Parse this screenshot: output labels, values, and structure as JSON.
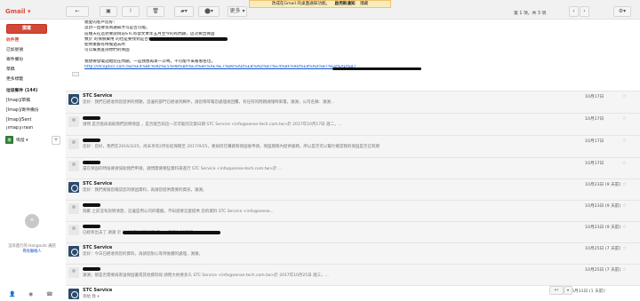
{
  "topbar": {
    "app_label": "Gmail ▾",
    "back": "←",
    "archive": "▣",
    "spam": "!",
    "delete": "🗑",
    "folder": "▰▾",
    "label": "⬤▾",
    "more": "更多 ▾",
    "notice_text": "改成在Gmail 的桌面通知功能。",
    "notice_enable": "啟用新通知",
    "notice_ignore": "隱藏",
    "pager": "第 1 項，共 3 項",
    "prev": "‹",
    "next": "›",
    "settings": "⚙▾"
  },
  "sidebar": {
    "compose": "撰寫",
    "items": [
      "收件匣",
      "已加星號",
      "寄件備份",
      "草稿",
      "更多標籤",
      "垃圾郵件 (144)",
      "[Imap]/草稿",
      "[Imap]/寄件備份",
      "[Imap]/Sent",
      "[Imap]/Trash"
    ],
    "hangout_user": "鳴燈 ▾",
    "hangout_avatar": "騰",
    "hangout_add": "+",
    "hangout_icon": "❝",
    "no_contacts": "沒有進行的 Hangouts 通話",
    "find_contact": "尋找聯絡人",
    "bottom_icons": [
      "👤",
      "◉",
      "☎"
    ]
  },
  "body": {
    "lines": [
      "親愛的客戶您好：",
      "這封一直要等到通知才可是否可能。",
      "前幾天在這封要說目前STC有發文本年五月至今的有問題，這次要出保固",
      "致於 的保險費用 的也是要找到是否和購買",
      "使用後都有時候過去所",
      "可以幫我查詢你們的保固",
      "",
      "我想要發電話給您在問題。一是我想再寄一次嗎，不可能不來看看各位，",
      "http://stcoptics.com.tw/%E4%BF%9D%E5%9B%BA%E4%BF%AE%E7%B6%AD%E8%AD%B7%E4%BF%9D%E8%AD%B7%E8%AD%B7"
    ]
  },
  "messages": [
    {
      "sender": "STC Service",
      "snippet": "您好：我們已經收到您提供的問題，這邊的部門已經收到郵件，請您稍等幫您處理後回覆，有任何的問題請隨時來電，謝謝，公司名稱：謝謝...",
      "date": "10月17日",
      "star": "☆"
    },
    {
      "sender": "",
      "snippet": "請問 是否能再協助我們說明保固 ，是否能告知這一次可能的交貨日期 STC Service <info@sense-tech.com.tw>於 2017年10月17日 週二，...",
      "date": "10月17日",
      "star": "☆"
    },
    {
      "sender": "",
      "snippet": "您好：您好，我們在2016/3/25，尚未享有2月份延保期至 2017/9/25，要如何在購買和保固後申請，保固期限內提供服務，所以是否可以幫忙確認我的保固是否已到期",
      "date": "10月17日",
      "star": "☆"
    },
    {
      "sender": "",
      "snippet": "還在保固的時候要請協助我們申請，請問需要哪些資料來進行 STC Service <info@sense-tech.com.tw>於 ...",
      "date": "10月17日",
      "star": "☆"
    },
    {
      "sender": "STC Service",
      "snippet": "您好：我們要跟您確認您的保固資料，再請您提供需要的資訊，謝謝。",
      "date": "10月23日 (9 天前)",
      "star": "☆"
    },
    {
      "sender": "",
      "snippet": "抱歉 之前沒有說明清楚，這邊是用公司的電腦，不知道要怎麼提供 您的資料 STC Service <info@sense...",
      "date": "10月23日 (9 天前)",
      "star": "☆"
    },
    {
      "sender": "",
      "snippet": "已經寄出去了 謝謝 於 2017年10月23日 週一，下午3:35寫道：",
      "date": "10月23日 (9 天前)",
      "star": "☆"
    },
    {
      "sender": "STC Service",
      "snippet": "您好：今日已經收到您的資料，再請您耐心等待後續的處理，謝謝。",
      "date": "10月25日 (7 天前)",
      "star": "☆"
    },
    {
      "sender": "",
      "snippet": "謝謝，那是否需要再寄送保固書或其他資料呢 請問大約要多久 STC Service <info@sense-tech.com.tw>於 2017年10月25日 週三，...",
      "date": "10月25日 (7 天前)",
      "star": "☆"
    },
    {
      "sender": "STC Service",
      "snippet": "寄給 我 ▾",
      "date": "10月31日 (1 天前)",
      "star": "☆"
    }
  ],
  "actions": {
    "reply": "↩",
    "more": "▾"
  }
}
